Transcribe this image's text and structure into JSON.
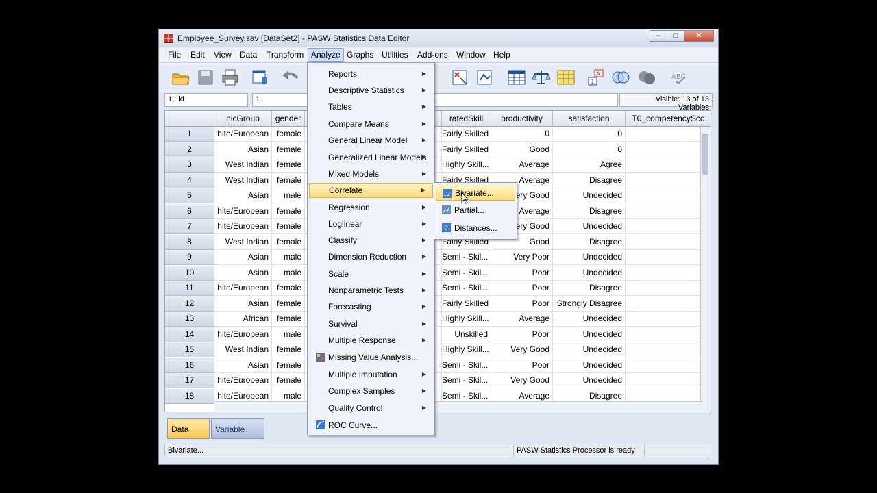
{
  "window": {
    "title": "Employee_Survey.sav [DataSet2] - PASW Statistics Data Editor",
    "buttons": {
      "minimize": "–",
      "maximize": "□",
      "close": "✕"
    }
  },
  "menubar": [
    "File",
    "Edit",
    "View",
    "Data",
    "Transform",
    "Analyze",
    "Graphs",
    "Utilities",
    "Add-ons",
    "Window",
    "Help"
  ],
  "cell_editor": {
    "ref": "1 : id",
    "value": "1",
    "visible": "Visible: 13 of 13 Variables"
  },
  "grid": {
    "columns": [
      "nicGroup",
      "gender",
      "",
      "ratedSkill",
      "productivity",
      "satisfaction",
      "T0_competencySco"
    ],
    "rows": [
      {
        "n": "1",
        "eth": "hite/European",
        "gender": "female",
        "skill": "Fairly Skilled",
        "prod": "0",
        "sat": "0"
      },
      {
        "n": "2",
        "eth": "Asian",
        "gender": "female",
        "skill": "Fairly Skilled",
        "prod": "Good",
        "sat": "0"
      },
      {
        "n": "3",
        "eth": "West Indian",
        "gender": "female",
        "skill": "Highly Skill...",
        "prod": "Average",
        "sat": "Agree"
      },
      {
        "n": "4",
        "eth": "West Indian",
        "gender": "female",
        "skill": "Fairly Skilled",
        "prod": "Average",
        "sat": "Disagree"
      },
      {
        "n": "5",
        "eth": "Asian",
        "gender": "male",
        "skill": "",
        "prod": "ery Good",
        "sat": "Undecided"
      },
      {
        "n": "6",
        "eth": "hite/European",
        "gender": "female",
        "skill": "",
        "prod": "Average",
        "sat": "Disagree"
      },
      {
        "n": "7",
        "eth": "hite/European",
        "gender": "female",
        "skill": "",
        "prod": "ery Good",
        "sat": "Undecided"
      },
      {
        "n": "8",
        "eth": "West Indian",
        "gender": "female",
        "skill": "Fairly Skilled",
        "prod": "Good",
        "sat": "Disagree"
      },
      {
        "n": "9",
        "eth": "Asian",
        "gender": "male",
        "skill": "Semi - Skil...",
        "prod": "Very Poor",
        "sat": "Undecided"
      },
      {
        "n": "10",
        "eth": "Asian",
        "gender": "male",
        "skill": "Semi - Skil...",
        "prod": "Poor",
        "sat": "Undecided"
      },
      {
        "n": "11",
        "eth": "hite/European",
        "gender": "female",
        "skill": "Semi - Skil...",
        "prod": "Poor",
        "sat": "Disagree"
      },
      {
        "n": "12",
        "eth": "Asian",
        "gender": "female",
        "skill": "Fairly Skilled",
        "prod": "Poor",
        "sat": "Strongly Disagree"
      },
      {
        "n": "13",
        "eth": "African",
        "gender": "female",
        "skill": "Highly Skill...",
        "prod": "Average",
        "sat": "Undecided"
      },
      {
        "n": "14",
        "eth": "hite/European",
        "gender": "male",
        "skill": "Unskilled",
        "prod": "Poor",
        "sat": "Undecided"
      },
      {
        "n": "15",
        "eth": "West Indian",
        "gender": "female",
        "skill": "Highly Skill...",
        "prod": "Very Good",
        "sat": "Undecided"
      },
      {
        "n": "16",
        "eth": "Asian",
        "gender": "female",
        "skill": "Semi - Skil...",
        "prod": "Poor",
        "sat": "Undecided"
      },
      {
        "n": "17",
        "eth": "hite/European",
        "gender": "female",
        "skill": "Semi - Skil...",
        "prod": "Very Good",
        "sat": "Undecided"
      },
      {
        "n": "18",
        "eth": "hite/European",
        "gender": "male",
        "skill": "Semi - Skil...",
        "prod": "Average",
        "sat": "Disagree"
      }
    ]
  },
  "analyze_menu": [
    {
      "label": "Reports",
      "submenu": true
    },
    {
      "label": "Descriptive Statistics",
      "submenu": true
    },
    {
      "label": "Tables",
      "submenu": true
    },
    {
      "label": "Compare Means",
      "submenu": true
    },
    {
      "label": "General Linear Model",
      "submenu": true
    },
    {
      "label": "Generalized Linear Models",
      "submenu": true
    },
    {
      "label": "Mixed Models",
      "submenu": true
    },
    {
      "label": "Correlate",
      "submenu": true
    },
    {
      "label": "Regression",
      "submenu": true
    },
    {
      "label": "Loglinear",
      "submenu": true
    },
    {
      "label": "Classify",
      "submenu": true
    },
    {
      "label": "Dimension Reduction",
      "submenu": true
    },
    {
      "label": "Scale",
      "submenu": true
    },
    {
      "label": "Nonparametric Tests",
      "submenu": true
    },
    {
      "label": "Forecasting",
      "submenu": true
    },
    {
      "label": "Survival",
      "submenu": true
    },
    {
      "label": "Multiple Response",
      "submenu": true
    },
    {
      "label": "Missing Value Analysis...",
      "submenu": false
    },
    {
      "label": "Multiple Imputation",
      "submenu": true
    },
    {
      "label": "Complex Samples",
      "submenu": true
    },
    {
      "label": "Quality Control",
      "submenu": true
    },
    {
      "label": "ROC Curve...",
      "submenu": false
    }
  ],
  "correlate_submenu": [
    "Bivariate...",
    "Partial...",
    "Distances..."
  ],
  "tabs": {
    "data_view": "Data View",
    "variable_view": "Variable View"
  },
  "status": {
    "left": "Bivariate...",
    "right": "PASW Statistics Processor is ready"
  },
  "colors": {
    "highlight": "#f9dc7c",
    "active_tab": "#f7c855",
    "menu_bg": "#f0f4fa"
  }
}
